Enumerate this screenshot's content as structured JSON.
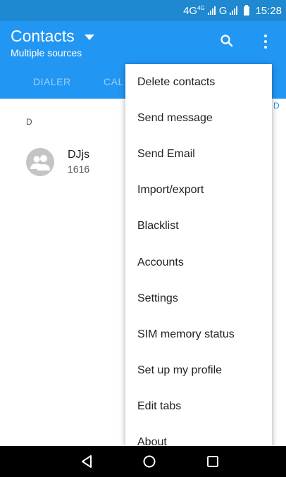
{
  "status_bar": {
    "network": "4G",
    "network_sup": "4G",
    "network2": "G",
    "time": "15:28"
  },
  "app_bar": {
    "title": "Contacts",
    "subtitle": "Multiple sources",
    "search_icon": "search-icon",
    "more_icon": "more-vert-icon"
  },
  "tabs": [
    {
      "label": "DIALER"
    },
    {
      "label": "CAL"
    }
  ],
  "list": {
    "section_letter": "D",
    "contacts": [
      {
        "name": "DJjs",
        "number": "1616"
      }
    ]
  },
  "menu": {
    "items": [
      {
        "label": "Delete contacts"
      },
      {
        "label": "Send message"
      },
      {
        "label": "Send Email"
      },
      {
        "label": "Import/export"
      },
      {
        "label": "Blacklist"
      },
      {
        "label": "Accounts"
      },
      {
        "label": "Settings"
      },
      {
        "label": "SIM memory status"
      },
      {
        "label": "Set up my profile"
      },
      {
        "label": "Edit tabs"
      },
      {
        "label": "About"
      }
    ]
  },
  "edge_hint": "D",
  "colors": {
    "primary": "#2196f3",
    "status_bar": "#1e88d0"
  }
}
